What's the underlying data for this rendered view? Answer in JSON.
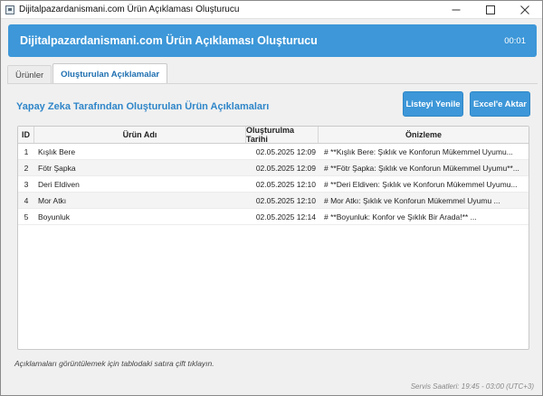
{
  "window": {
    "title": "Dijitalpazardanismani.com Ürün Açıklaması Oluşturucu"
  },
  "header": {
    "title": "Dijitalpazardanismani.com Ürün Açıklaması Oluşturucu",
    "timer": "00:01"
  },
  "tabs": [
    {
      "label": "Ürünler",
      "active": false
    },
    {
      "label": "Oluşturulan Açıklamalar",
      "active": true
    }
  ],
  "section": {
    "title": "Yapay Zeka Tarafından Oluşturulan Ürün Açıklamaları",
    "refresh_label": "Listeyi Yenile",
    "export_label": "Excel'e Aktar"
  },
  "table": {
    "columns": [
      "ID",
      "Ürün Adı",
      "Oluşturulma Tarihi",
      "Önizleme"
    ],
    "rows": [
      {
        "id": "1",
        "name": "Kışlık Bere",
        "date": "02.05.2025 12:09",
        "preview": "# **Kışlık Bere: Şıklık ve Konforun Mükemmel Uyumu..."
      },
      {
        "id": "2",
        "name": "Fötr Şapka",
        "date": "02.05.2025 12:09",
        "preview": "# **Fötr Şapka: Şıklık ve Konforun Mükemmel Uyumu**..."
      },
      {
        "id": "3",
        "name": "Deri Eldiven",
        "date": "02.05.2025 12:10",
        "preview": "# **Deri Eldiven: Şıklık ve Konforun Mükemmel Uyumu..."
      },
      {
        "id": "4",
        "name": "Mor Atkı",
        "date": "02.05.2025 12:10",
        "preview": "# Mor Atkı: Şıklık ve Konforun Mükemmel Uyumu  ..."
      },
      {
        "id": "5",
        "name": "Boyunluk",
        "date": "02.05.2025 12:14",
        "preview": "# **Boyunluk: Konfor ve Şıklık Bir Arada!**  ..."
      }
    ]
  },
  "hint": "Açıklamaları görüntülemek için tablodaki satıra çift tıklayın.",
  "footer": "Servis Saatleri: 19:45 - 03:00 (UTC+3)",
  "colors": {
    "accent": "#3d97d8",
    "section_title": "#2f86c9"
  }
}
